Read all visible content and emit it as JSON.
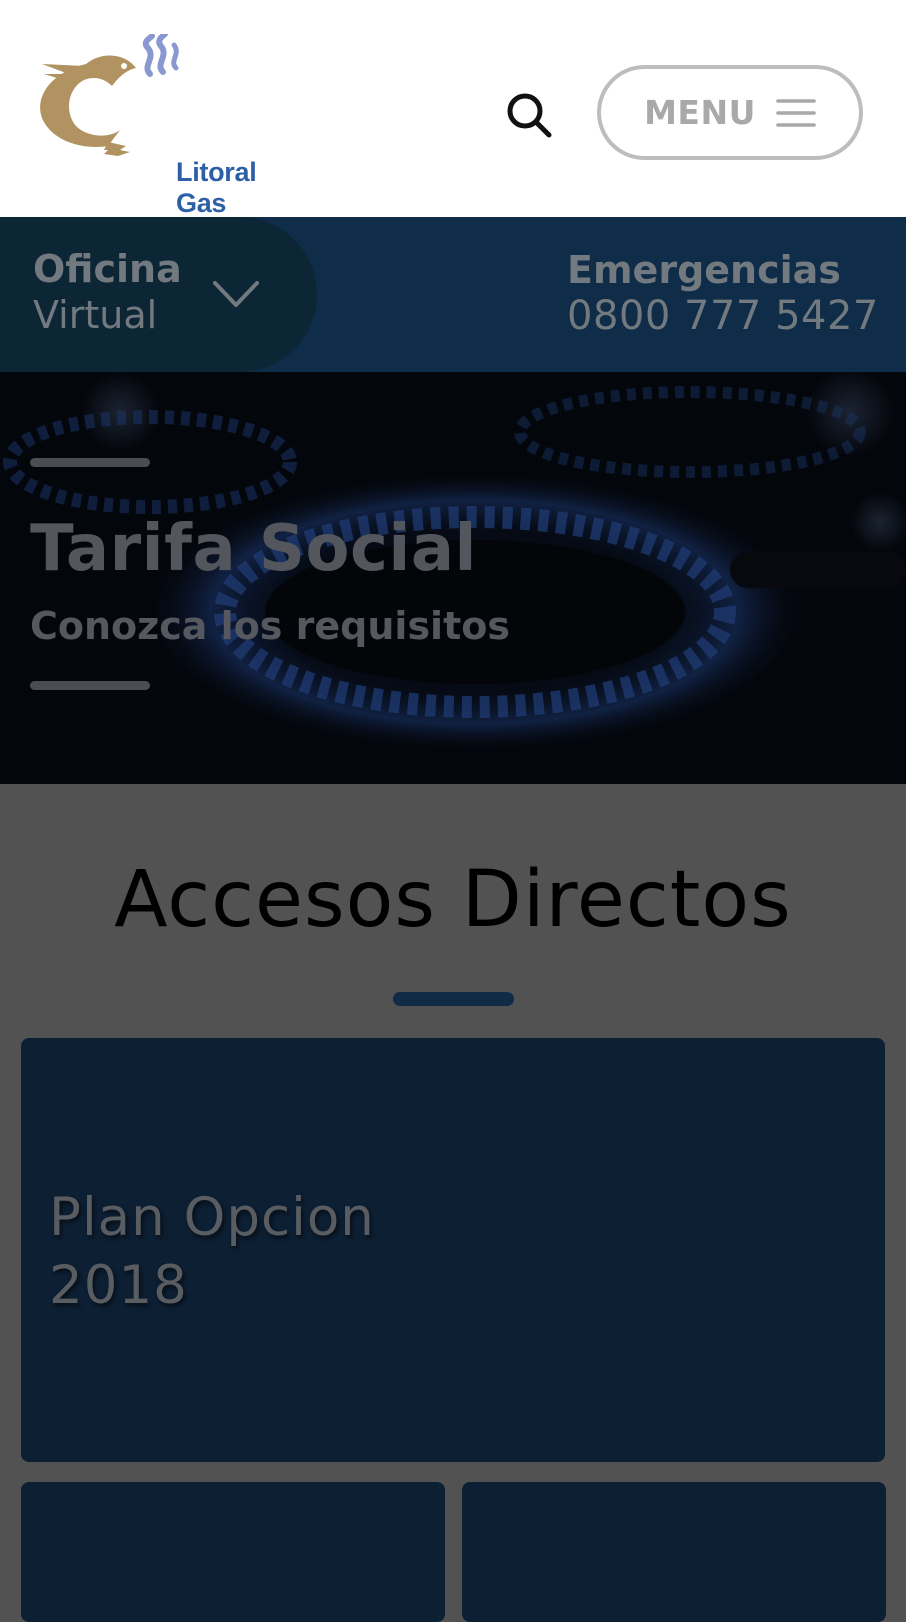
{
  "header": {
    "logo_text": "Litoral Gas",
    "menu_label": "MENU",
    "icons": {
      "search": "search-icon",
      "menu": "hamburger-icon",
      "logo": "fish-logo-icon"
    }
  },
  "bar": {
    "oficina_line1": "Oficina",
    "oficina_line2": "Virtual",
    "emergencias_label": "Emergencias",
    "emergencias_phone": "0800 777 5427",
    "icons": {
      "dropdown": "chevron-down-icon"
    }
  },
  "hero": {
    "title": "Tarifa Social",
    "subtitle": "Conozca los requisitos"
  },
  "accesos": {
    "title": "Accesos Directos",
    "cards": [
      {
        "title": "Plan Opcion 2018"
      }
    ]
  },
  "colors": {
    "brand_blue": "#2d5fa6",
    "brand_gold": "#b09360",
    "bar_blue": "#0f2c48",
    "card_blue": "#0d1f33",
    "overlay_gray": "#525252"
  }
}
